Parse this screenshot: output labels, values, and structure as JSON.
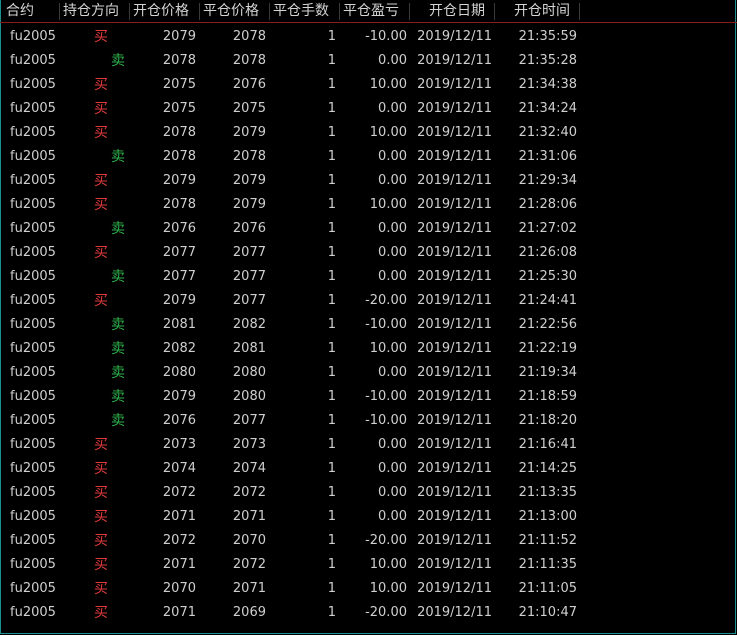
{
  "headers": {
    "contract": "合约",
    "direction": "持仓方向",
    "open_price": "开仓价格",
    "close_price": "平仓价格",
    "close_qty": "平仓手数",
    "close_pnl": "平仓盈亏",
    "open_date": "开仓日期",
    "open_time": "开仓时间"
  },
  "colors": {
    "buy": "#e03a3a",
    "sell": "#2fb24a",
    "text": "#cfcfcf",
    "header_border": "#8a1e1e",
    "frame_border": "#1c8f8f"
  },
  "rows": [
    {
      "contract": "fu2005",
      "direction": "买",
      "side": "buy",
      "open_price": "2079",
      "close_price": "2078",
      "qty": "1",
      "pnl": "-10.00",
      "date": "2019/12/11",
      "time": "21:35:59"
    },
    {
      "contract": "fu2005",
      "direction": "卖",
      "side": "sell",
      "open_price": "2078",
      "close_price": "2078",
      "qty": "1",
      "pnl": "0.00",
      "date": "2019/12/11",
      "time": "21:35:28"
    },
    {
      "contract": "fu2005",
      "direction": "买",
      "side": "buy",
      "open_price": "2075",
      "close_price": "2076",
      "qty": "1",
      "pnl": "10.00",
      "date": "2019/12/11",
      "time": "21:34:38"
    },
    {
      "contract": "fu2005",
      "direction": "买",
      "side": "buy",
      "open_price": "2075",
      "close_price": "2075",
      "qty": "1",
      "pnl": "0.00",
      "date": "2019/12/11",
      "time": "21:34:24"
    },
    {
      "contract": "fu2005",
      "direction": "买",
      "side": "buy",
      "open_price": "2078",
      "close_price": "2079",
      "qty": "1",
      "pnl": "10.00",
      "date": "2019/12/11",
      "time": "21:32:40"
    },
    {
      "contract": "fu2005",
      "direction": "卖",
      "side": "sell",
      "open_price": "2078",
      "close_price": "2078",
      "qty": "1",
      "pnl": "0.00",
      "date": "2019/12/11",
      "time": "21:31:06"
    },
    {
      "contract": "fu2005",
      "direction": "买",
      "side": "buy",
      "open_price": "2079",
      "close_price": "2079",
      "qty": "1",
      "pnl": "0.00",
      "date": "2019/12/11",
      "time": "21:29:34"
    },
    {
      "contract": "fu2005",
      "direction": "买",
      "side": "buy",
      "open_price": "2078",
      "close_price": "2079",
      "qty": "1",
      "pnl": "10.00",
      "date": "2019/12/11",
      "time": "21:28:06"
    },
    {
      "contract": "fu2005",
      "direction": "卖",
      "side": "sell",
      "open_price": "2076",
      "close_price": "2076",
      "qty": "1",
      "pnl": "0.00",
      "date": "2019/12/11",
      "time": "21:27:02"
    },
    {
      "contract": "fu2005",
      "direction": "买",
      "side": "buy",
      "open_price": "2077",
      "close_price": "2077",
      "qty": "1",
      "pnl": "0.00",
      "date": "2019/12/11",
      "time": "21:26:08"
    },
    {
      "contract": "fu2005",
      "direction": "卖",
      "side": "sell",
      "open_price": "2077",
      "close_price": "2077",
      "qty": "1",
      "pnl": "0.00",
      "date": "2019/12/11",
      "time": "21:25:30"
    },
    {
      "contract": "fu2005",
      "direction": "买",
      "side": "buy",
      "open_price": "2079",
      "close_price": "2077",
      "qty": "1",
      "pnl": "-20.00",
      "date": "2019/12/11",
      "time": "21:24:41"
    },
    {
      "contract": "fu2005",
      "direction": "卖",
      "side": "sell",
      "open_price": "2081",
      "close_price": "2082",
      "qty": "1",
      "pnl": "-10.00",
      "date": "2019/12/11",
      "time": "21:22:56"
    },
    {
      "contract": "fu2005",
      "direction": "卖",
      "side": "sell",
      "open_price": "2082",
      "close_price": "2081",
      "qty": "1",
      "pnl": "10.00",
      "date": "2019/12/11",
      "time": "21:22:19"
    },
    {
      "contract": "fu2005",
      "direction": "卖",
      "side": "sell",
      "open_price": "2080",
      "close_price": "2080",
      "qty": "1",
      "pnl": "0.00",
      "date": "2019/12/11",
      "time": "21:19:34"
    },
    {
      "contract": "fu2005",
      "direction": "卖",
      "side": "sell",
      "open_price": "2079",
      "close_price": "2080",
      "qty": "1",
      "pnl": "-10.00",
      "date": "2019/12/11",
      "time": "21:18:59"
    },
    {
      "contract": "fu2005",
      "direction": "卖",
      "side": "sell",
      "open_price": "2076",
      "close_price": "2077",
      "qty": "1",
      "pnl": "-10.00",
      "date": "2019/12/11",
      "time": "21:18:20"
    },
    {
      "contract": "fu2005",
      "direction": "买",
      "side": "buy",
      "open_price": "2073",
      "close_price": "2073",
      "qty": "1",
      "pnl": "0.00",
      "date": "2019/12/11",
      "time": "21:16:41"
    },
    {
      "contract": "fu2005",
      "direction": "买",
      "side": "buy",
      "open_price": "2074",
      "close_price": "2074",
      "qty": "1",
      "pnl": "0.00",
      "date": "2019/12/11",
      "time": "21:14:25"
    },
    {
      "contract": "fu2005",
      "direction": "买",
      "side": "buy",
      "open_price": "2072",
      "close_price": "2072",
      "qty": "1",
      "pnl": "0.00",
      "date": "2019/12/11",
      "time": "21:13:35"
    },
    {
      "contract": "fu2005",
      "direction": "买",
      "side": "buy",
      "open_price": "2071",
      "close_price": "2071",
      "qty": "1",
      "pnl": "0.00",
      "date": "2019/12/11",
      "time": "21:13:00"
    },
    {
      "contract": "fu2005",
      "direction": "买",
      "side": "buy",
      "open_price": "2072",
      "close_price": "2070",
      "qty": "1",
      "pnl": "-20.00",
      "date": "2019/12/11",
      "time": "21:11:52"
    },
    {
      "contract": "fu2005",
      "direction": "买",
      "side": "buy",
      "open_price": "2071",
      "close_price": "2072",
      "qty": "1",
      "pnl": "10.00",
      "date": "2019/12/11",
      "time": "21:11:35"
    },
    {
      "contract": "fu2005",
      "direction": "买",
      "side": "buy",
      "open_price": "2070",
      "close_price": "2071",
      "qty": "1",
      "pnl": "10.00",
      "date": "2019/12/11",
      "time": "21:11:05"
    },
    {
      "contract": "fu2005",
      "direction": "买",
      "side": "buy",
      "open_price": "2071",
      "close_price": "2069",
      "qty": "1",
      "pnl": "-20.00",
      "date": "2019/12/11",
      "time": "21:10:47"
    }
  ]
}
